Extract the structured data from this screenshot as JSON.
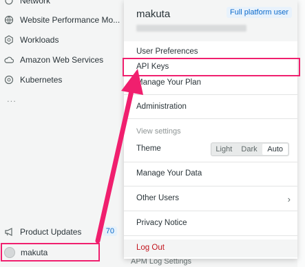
{
  "sidebar": {
    "items": [
      {
        "label": "Network",
        "icon": "network-icon"
      },
      {
        "label": "Website Performance Mo...",
        "icon": "globe-icon"
      },
      {
        "label": "Workloads",
        "icon": "hexagon-icon"
      },
      {
        "label": "Amazon Web Services",
        "icon": "cloud-icon"
      },
      {
        "label": "Kubernetes",
        "icon": "kubernetes-icon"
      }
    ],
    "more": "...",
    "product_updates": {
      "label": "Product Updates",
      "count": "70"
    },
    "user": {
      "label": "makuta"
    }
  },
  "menu": {
    "name": "makuta",
    "platform_badge": "Full platform user",
    "items": {
      "user_preferences": "User Preferences",
      "api_keys": "API Keys",
      "manage_plan": "Manage Your Plan",
      "administration": "Administration",
      "view_settings": "View settings",
      "theme": "Theme",
      "manage_data": "Manage Your Data",
      "other_users": "Other Users",
      "privacy_notice": "Privacy Notice",
      "log_out": "Log Out"
    },
    "theme_options": [
      "Light",
      "Dark",
      "Auto"
    ],
    "theme_selected": "Auto"
  },
  "footer": {
    "apm": "APM Log Settings"
  },
  "colors": {
    "highlight": "#f01f6e",
    "accent": "#0b6acb",
    "logout": "#c2141d"
  }
}
